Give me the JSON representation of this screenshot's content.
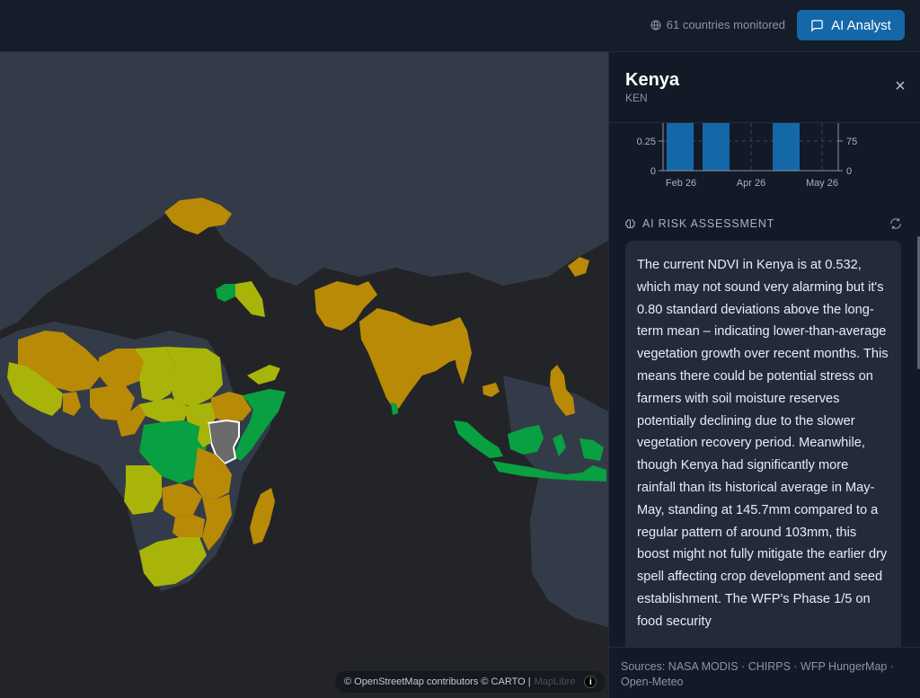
{
  "header": {
    "monitored_text": "61 countries monitored",
    "ai_button_label": "AI Analyst"
  },
  "map": {
    "attribution": "© OpenStreetMap contributors © CARTO |",
    "attribution_engine": "MapLibre",
    "info_glyph": "i",
    "legend_colors": {
      "selected": "#6b6b6b",
      "high_risk": "#b88a06",
      "moderate_risk": "#a8b40a",
      "low_risk": "#08a040"
    }
  },
  "panel": {
    "country_name": "Kenya",
    "country_code": "KEN",
    "close_glyph": "×",
    "chart": {
      "left_ticks": [
        "0.25",
        "0"
      ],
      "right_ticks": [
        "75",
        "0"
      ],
      "x_ticks": [
        "Feb 26",
        "Apr 26",
        "May 26"
      ]
    },
    "ai_section_title": "AI RISK ASSESSMENT",
    "assessment_text": "The current NDVI in Kenya is at 0.532, which may not sound very alarming but it's 0.80 standard deviations above the long-term mean – indicating lower-than-average vegetation growth over recent months. This means there could be potential stress on farmers with soil moisture reserves potentially declining due to the slower vegetation recovery period. Meanwhile, though Kenya had significantly more rainfall than its historical average in May-May, standing at 145.7mm compared to a regular pattern of around 103mm, this boost might not fully mitigate the earlier dry spell affecting crop development and seed establishment. The WFP's Phase 1/5 on food security",
    "sources": "Sources: NASA MODIS · CHIRPS · WFP HungerMap · Open-Meteo"
  }
}
